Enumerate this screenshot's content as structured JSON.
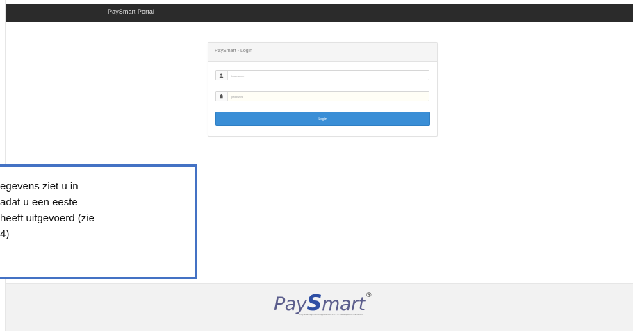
{
  "app": {
    "brand": "PaySmart Portal"
  },
  "login": {
    "title": "PaySmart - Login",
    "username_placeholder": "Username",
    "password_placeholder": "password",
    "login_label": "Login",
    "icons": {
      "username": "user-icon",
      "password": "home-icon"
    }
  },
  "callout": {
    "lines": [
      "egevens   ziet   u   in",
      "adat   u   een   eeste",
      "heeft  uitgevoerd  (zie",
      "4)"
    ],
    "border_color": "#4472c4"
  },
  "footer": {
    "logo_pre": "Pay",
    "logo_s": "S",
    "logo_post": "mart",
    "logo_registered": "®",
    "small_text": "PaySmart Mijn Admin App Version 6.1.17 – Developed by PaySmart"
  },
  "colors": {
    "topbar": "#2b2b2b",
    "login_button": "#3a8ed6"
  }
}
